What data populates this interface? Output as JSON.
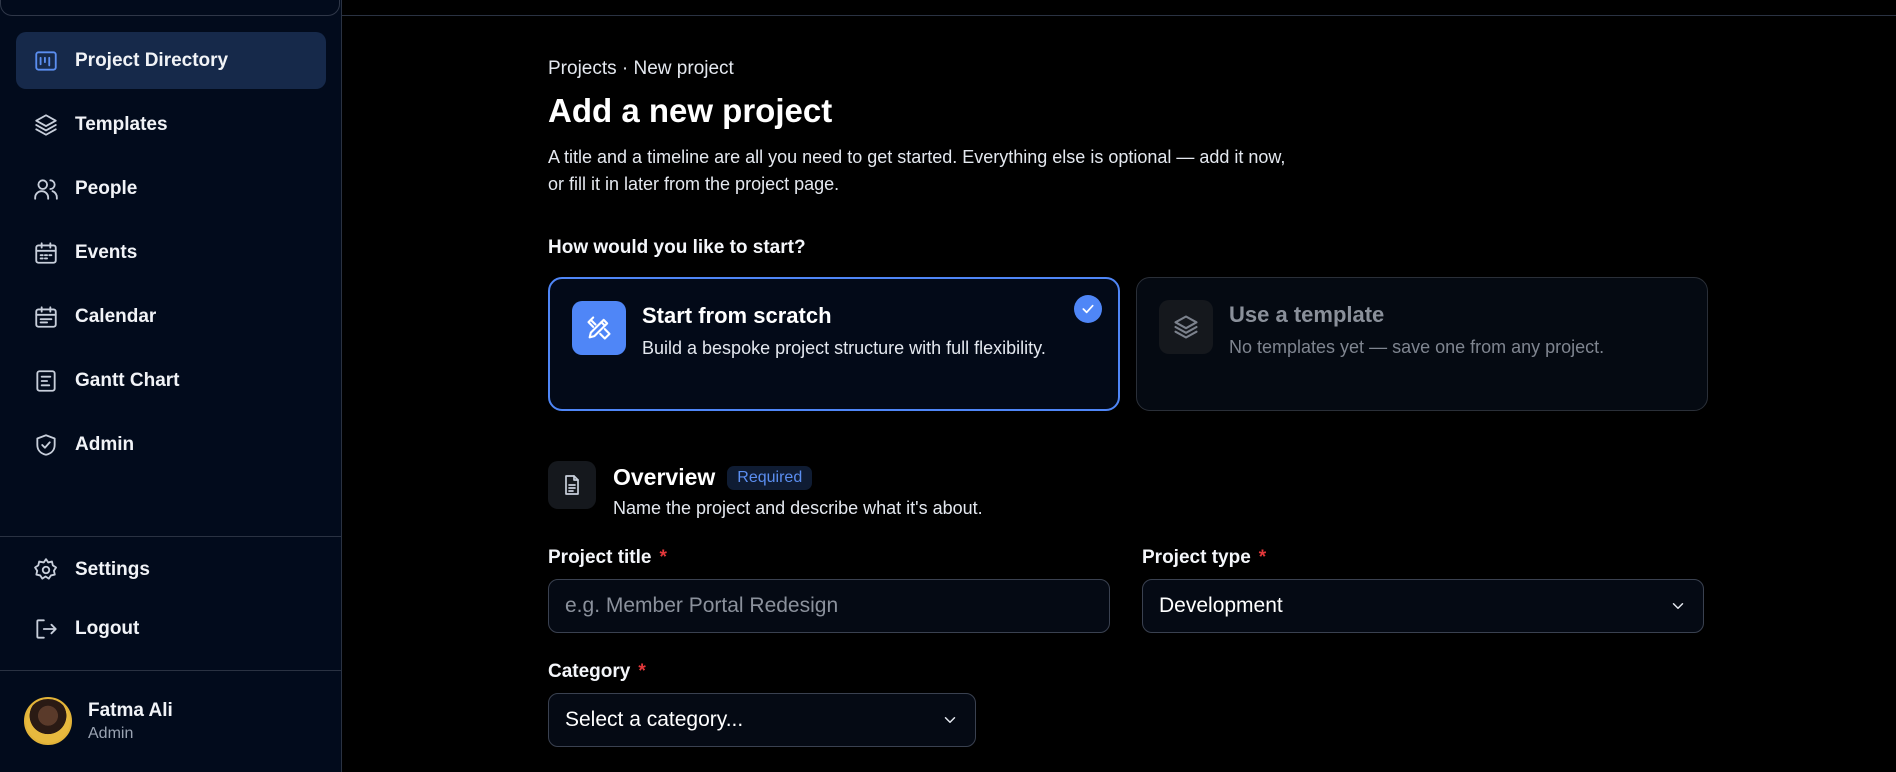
{
  "sidebar": {
    "items": [
      {
        "label": "Project Directory",
        "icon": "chart-board-icon",
        "active": true
      },
      {
        "label": "Templates",
        "icon": "layers-icon"
      },
      {
        "label": "People",
        "icon": "people-icon"
      },
      {
        "label": "Events",
        "icon": "calendar-icon"
      },
      {
        "label": "Calendar",
        "icon": "calendar-grid-icon"
      },
      {
        "label": "Gantt Chart",
        "icon": "gantt-icon"
      },
      {
        "label": "Admin",
        "icon": "shield-check-icon"
      }
    ],
    "bottom": [
      {
        "label": "Settings",
        "icon": "gear-icon"
      },
      {
        "label": "Logout",
        "icon": "logout-icon"
      }
    ],
    "user": {
      "name": "Fatma Ali",
      "role": "Admin"
    }
  },
  "main": {
    "breadcrumb": "Projects · New project",
    "title": "Add a new project",
    "description": "A title and a timeline are all you need to get started. Everything else is optional — add it now, or fill it in later from the project page.",
    "start_question": "How would you like to start?",
    "start_options": [
      {
        "title": "Start from scratch",
        "desc": "Build a bespoke project structure with full flexibility.",
        "selected": true
      },
      {
        "title": "Use a template",
        "desc": "No templates yet — save one from any project.",
        "disabled": true
      }
    ],
    "overview": {
      "title": "Overview",
      "badge": "Required",
      "desc": "Name the project and describe what it's about."
    },
    "fields": {
      "project_title": {
        "label": "Project title",
        "required_mark": "*",
        "placeholder": "e.g. Member Portal Redesign"
      },
      "project_type": {
        "label": "Project type",
        "required_mark": "*",
        "value": "Development"
      },
      "category": {
        "label": "Category",
        "required_mark": "*",
        "value": "Select a category..."
      }
    }
  },
  "colors": {
    "accent": "#4f86f7",
    "sidebar_bg": "#020b1c",
    "active_bg": "#16294a",
    "required": "#e5383b"
  }
}
